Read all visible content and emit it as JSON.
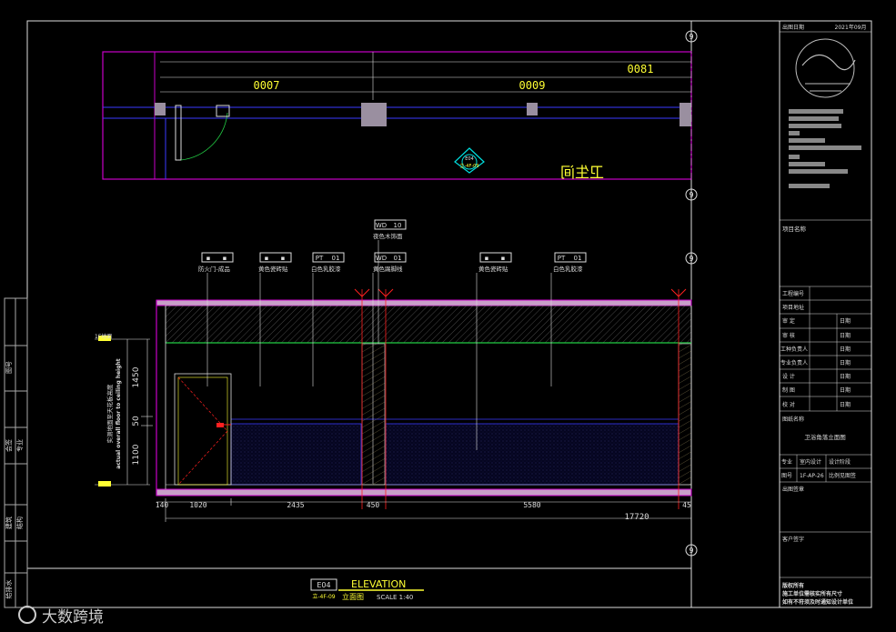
{
  "plan": {
    "dims": [
      "0007",
      "0009",
      "0081"
    ],
    "room_label": "卫生间",
    "marker": {
      "code": "E04",
      "sheet": "立-4F-09"
    }
  },
  "grid_bubbles": [
    "9",
    "9",
    "9",
    "9"
  ],
  "tags": [
    {
      "code": "WD",
      "num": "10",
      "desc": "夜色木饰面"
    },
    {
      "code": "▪",
      "num": "▪",
      "desc": "防火门-成品"
    },
    {
      "code": "▪",
      "num": "▪",
      "desc": "黄色瓷砖贴"
    },
    {
      "code": "PT",
      "num": "01",
      "desc": "白色乳胶漆"
    },
    {
      "code": "WD",
      "num": "01",
      "desc": "黄色踢脚线"
    },
    {
      "code": "▪",
      "num": "▪",
      "desc": "黄色瓷砖贴"
    },
    {
      "code": "PT",
      "num": "01",
      "desc": "白色乳胶漆"
    }
  ],
  "elevation": {
    "level_label": "1F地面",
    "height_dims": [
      "1450",
      "50",
      "1100"
    ],
    "height_note_cn": "实测地面至天花板高度",
    "height_note_en": "actual overall floor to ceiling height",
    "width_dims": [
      "140",
      "1020",
      "2435",
      "450",
      "5580",
      "45"
    ],
    "total_width": "17720"
  },
  "title_block": {
    "date_label": "出图日期",
    "date_value": "2021年09月",
    "project_label": "项目名称",
    "rows": [
      {
        "label": "工程编号",
        "value": ""
      },
      {
        "label": "项目地址",
        "value": ""
      },
      {
        "label": "审 定",
        "value": "日期"
      },
      {
        "label": "审 核",
        "value": "日期"
      },
      {
        "label": "工种负责人",
        "value": "日期"
      },
      {
        "label": "专业负责人",
        "value": "日期"
      },
      {
        "label": "设 计",
        "value": "日期"
      },
      {
        "label": "制 图",
        "value": "日期"
      },
      {
        "label": "校 对",
        "value": "日期"
      }
    ],
    "drawing_name_label": "图纸名称",
    "drawing_name": "卫浴角落立面图",
    "discipline_label": "专业",
    "discipline_value": "室内设计",
    "stage_label": "设计阶段",
    "number_label": "图号",
    "number_value": "1F-AP-26",
    "scale_label": "比例见图签",
    "signature_label": "出图签章",
    "client_label": "客户签字",
    "copyright": [
      "版权所有",
      "施工单位需核实所有尺寸",
      "如有不符须及时通知设计单位"
    ]
  },
  "left_strip": [
    "图号",
    "会签",
    "专业",
    "建筑",
    "结构",
    "给排水"
  ],
  "title": {
    "code": "E04",
    "sub": "立-4F-09",
    "name": "ELEVATION",
    "cn": "立面图",
    "scale": "SCALE 1:40"
  },
  "watermark": "大数跨境",
  "colors": {
    "magenta": "#c800c8",
    "yellow": "#ffff33",
    "white": "#ffffff",
    "blue": "#3a3aff",
    "red": "#ff2020",
    "green": "#22cc44",
    "cyan": "#00e0e0"
  }
}
